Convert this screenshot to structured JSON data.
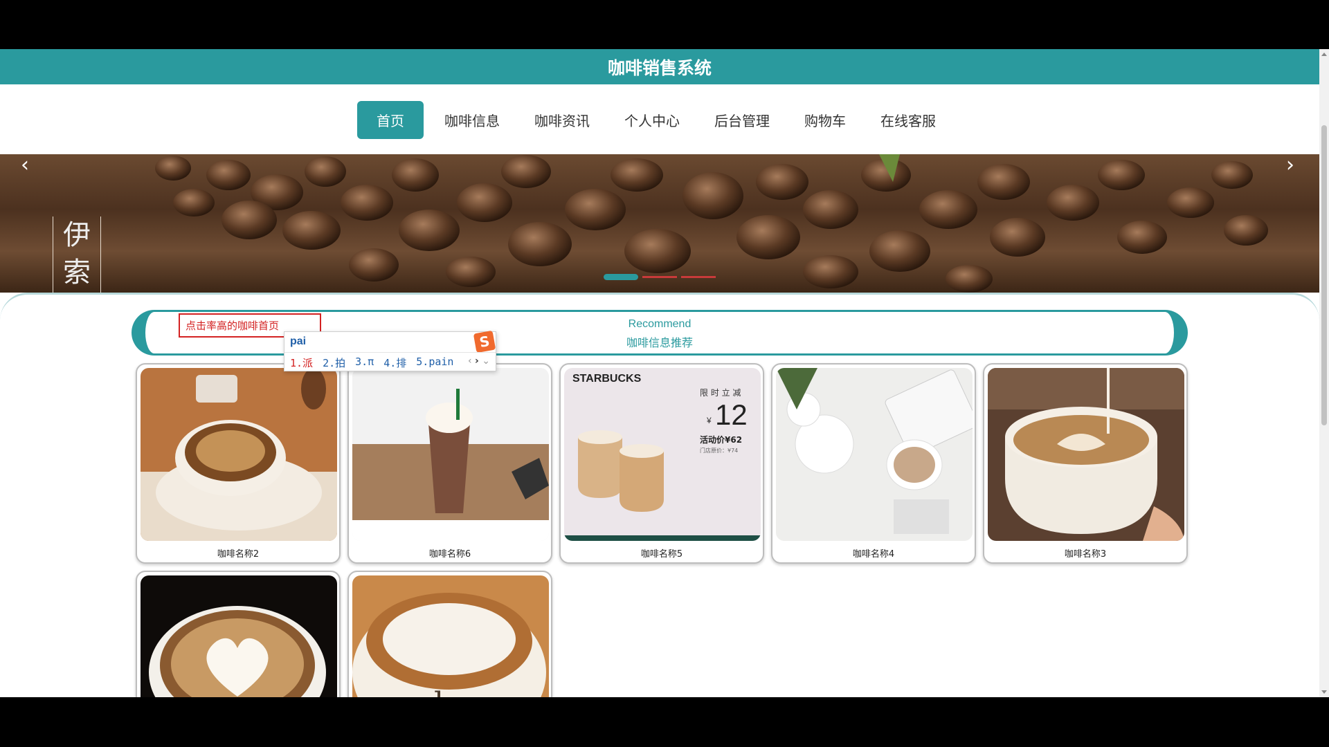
{
  "header": {
    "title": "咖啡销售系统"
  },
  "nav": {
    "items": [
      {
        "label": "首页",
        "active": true
      },
      {
        "label": "咖啡信息",
        "active": false
      },
      {
        "label": "咖啡资讯",
        "active": false
      },
      {
        "label": "个人中心",
        "active": false
      },
      {
        "label": "后台管理",
        "active": false
      },
      {
        "label": "购物车",
        "active": false
      },
      {
        "label": "在线客服",
        "active": false
      }
    ]
  },
  "banner": {
    "side_text_1": "伊",
    "side_text_2": "索",
    "prev_icon": "chevron-left-icon",
    "next_icon": "chevron-right-icon",
    "active_slide": 1,
    "slide_count": 3
  },
  "recommend": {
    "title_en": "Recommend",
    "title_cn": "咖啡信息推荐"
  },
  "search": {
    "value": "点击率高的咖啡首页"
  },
  "ime": {
    "typed": "pai",
    "logo": "S",
    "candidates": [
      "1.派",
      "2.拍",
      "3.π",
      "4.排",
      "5.pain"
    ],
    "prev": "‹",
    "next": "›",
    "expand": "⌄"
  },
  "products": [
    {
      "name": "咖啡名称2",
      "image": "latte-cup-on-table"
    },
    {
      "name": "咖啡名称6",
      "image": "frappe-glass"
    },
    {
      "name": "咖啡名称5",
      "image": "starbucks-promo",
      "promo": {
        "brand": "STARBUCKS",
        "headline": "限 时 立 减",
        "price": "12",
        "currency": "¥",
        "sale": "活动价¥62",
        "original": "门店原价：¥74"
      }
    },
    {
      "name": "咖啡名称4",
      "image": "coffee-desk-flowers"
    },
    {
      "name": "咖啡名称3",
      "image": "latte-art-pour"
    },
    {
      "name": "",
      "image": "heart-latte"
    },
    {
      "name": "",
      "image": "foam-cup"
    }
  ],
  "colors": {
    "accent": "#2a9a9e",
    "highlight": "#d32222"
  }
}
